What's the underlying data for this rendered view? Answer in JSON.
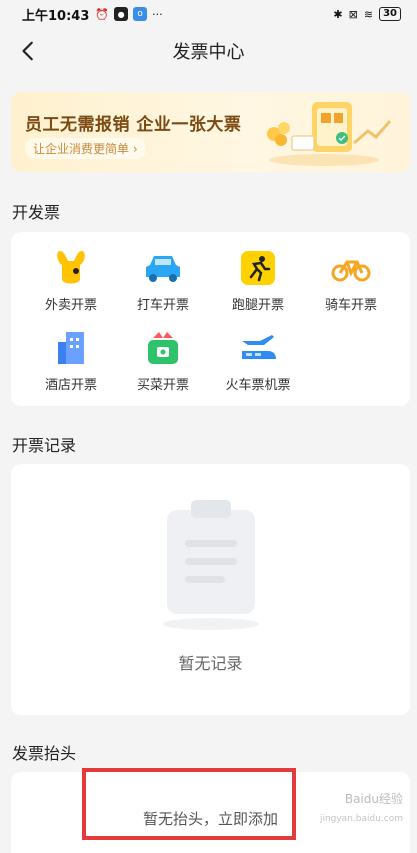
{
  "status_bar": {
    "time": "上午10:43",
    "extra": "···",
    "battery": "30"
  },
  "nav": {
    "title": "发票中心"
  },
  "banner": {
    "title": "员工无需报销 企业一张大票",
    "subtitle": "让企业消费更简单 ›"
  },
  "issue_section": {
    "title": "开发票",
    "items": [
      {
        "label": "外卖开票",
        "icon": "takeout-kangaroo-icon",
        "color": "#ffc300"
      },
      {
        "label": "打车开票",
        "icon": "car-icon",
        "color": "#2aa6f4"
      },
      {
        "label": "跑腿开票",
        "icon": "runner-icon",
        "color": "#ffd100"
      },
      {
        "label": "骑车开票",
        "icon": "bike-icon",
        "color": "#f5a623"
      },
      {
        "label": "酒店开票",
        "icon": "hotel-icon",
        "color": "#3b7ff2"
      },
      {
        "label": "买菜开票",
        "icon": "grocery-basket-icon",
        "color": "#2ec36b"
      },
      {
        "label": "火车票机票",
        "icon": "train-plane-icon",
        "color": "#2f8cf2"
      }
    ]
  },
  "records_section": {
    "title": "开票记录",
    "empty_text": "暂无记录"
  },
  "header_section": {
    "title": "发票抬头",
    "empty_text": "暂无抬头，立即添加"
  },
  "watermark": {
    "text": "Baidu经验",
    "sub": "jingyan.baidu.com"
  }
}
